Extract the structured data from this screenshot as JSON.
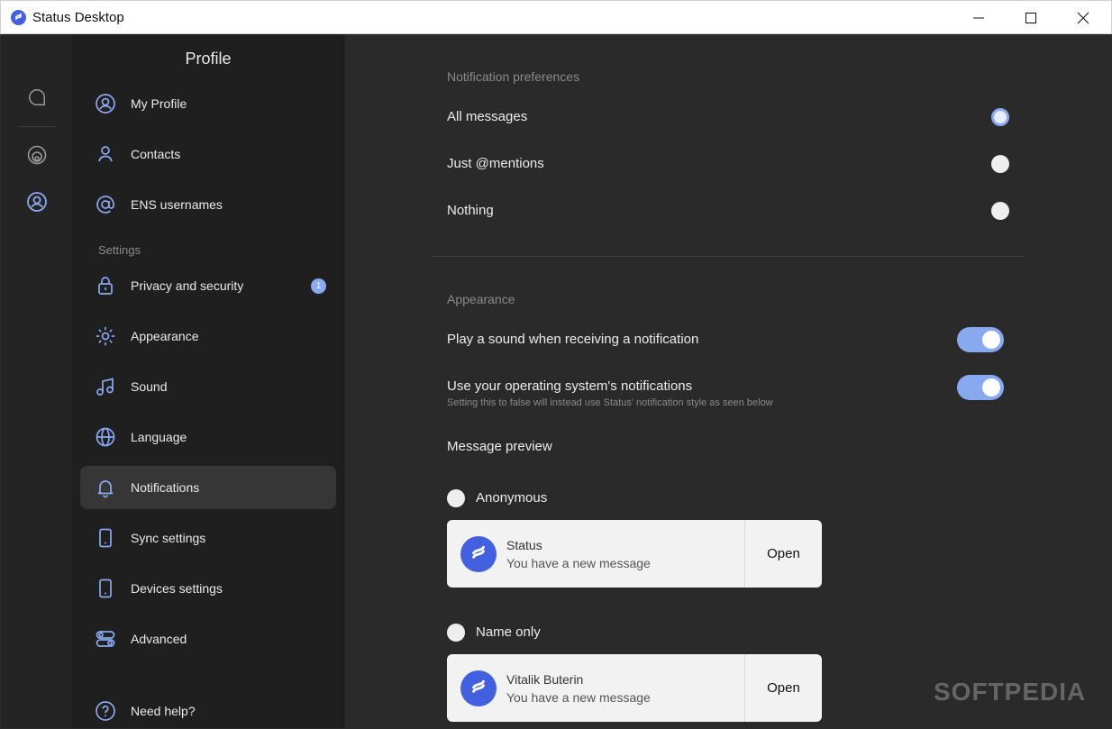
{
  "window": {
    "title": "Status Desktop",
    "controls": [
      "minimize-icon",
      "maximize-icon",
      "close-icon"
    ]
  },
  "rail": {
    "items": [
      {
        "icon": "chat-icon"
      },
      {
        "icon": "communities-icon"
      },
      {
        "icon": "profile-icon",
        "active": true
      }
    ]
  },
  "nav": {
    "title": "Profile",
    "items": [
      {
        "label": "My Profile",
        "icon": "user-circle-icon"
      },
      {
        "label": "Contacts",
        "icon": "user-icon"
      },
      {
        "label": "ENS usernames",
        "icon": "at-icon"
      }
    ],
    "settings_label": "Settings",
    "settings_items": [
      {
        "label": "Privacy and security",
        "icon": "lock-icon",
        "badge": "1"
      },
      {
        "label": "Appearance",
        "icon": "sun-icon"
      },
      {
        "label": "Sound",
        "icon": "music-icon"
      },
      {
        "label": "Language",
        "icon": "globe-icon"
      },
      {
        "label": "Notifications",
        "icon": "bell-icon",
        "active": true
      },
      {
        "label": "Sync settings",
        "icon": "phone-icon"
      },
      {
        "label": "Devices settings",
        "icon": "phone-icon"
      },
      {
        "label": "Advanced",
        "icon": "sliders-icon"
      }
    ],
    "help_label": "Need help?",
    "help_icon": "help-circle-icon"
  },
  "notifications": {
    "prefs_title": "Notification preferences",
    "options": [
      {
        "label": "All messages",
        "selected": true
      },
      {
        "label": "Just @mentions",
        "selected": false
      },
      {
        "label": "Nothing",
        "selected": false
      }
    ]
  },
  "appearance": {
    "title": "Appearance",
    "sound_label": "Play a sound when receiving a notification",
    "sound_on": true,
    "os_label": "Use your operating system's notifications",
    "os_sublabel": "Setting this to false will instead use Status' notification style as seen below",
    "os_on": true,
    "preview_label": "Message preview",
    "previews": [
      {
        "option": "Anonymous",
        "name": "Status",
        "message": "You have a new message",
        "action": "Open"
      },
      {
        "option": "Name only",
        "name": "Vitalik Buterin",
        "message": "You have a new message",
        "action": "Open"
      }
    ]
  },
  "colors": {
    "accent": "#4360df",
    "toggle": "#88a8f0",
    "background": "#2a2a2a",
    "nav": "#1f1f1f",
    "rail": "#242424"
  },
  "watermark": "SOFTPEDIA"
}
